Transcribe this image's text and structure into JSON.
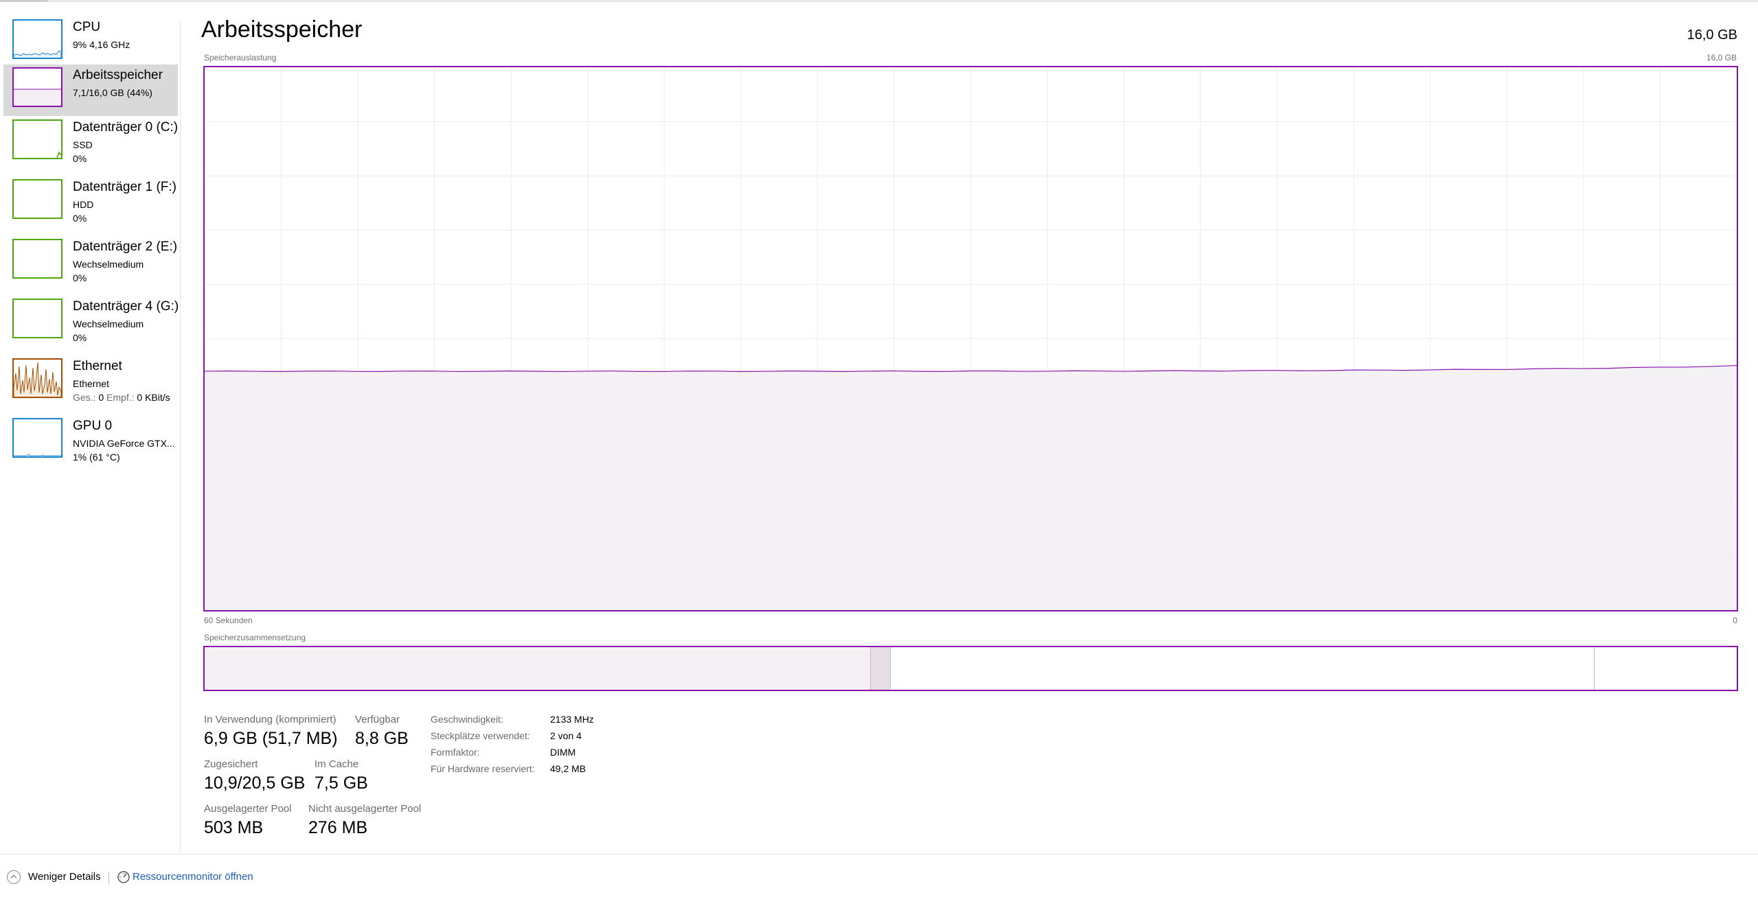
{
  "sidebar": {
    "items": [
      {
        "title": "CPU",
        "line1": "9%  4,16 GHz",
        "line2": "",
        "color": "#1b86d1",
        "selected": false
      },
      {
        "title": "Arbeitsspeicher",
        "line1": "7,1/16,0 GB (44%)",
        "line2": "",
        "color": "#8b12ae",
        "selected": true
      },
      {
        "title": "Datenträger 0 (C:)",
        "line1": "SSD",
        "line2": "0%",
        "color": "#4da60c",
        "selected": false
      },
      {
        "title": "Datenträger 1 (F:)",
        "line1": "HDD",
        "line2": "0%",
        "color": "#4da60c",
        "selected": false
      },
      {
        "title": "Datenträger 2 (E:)",
        "line1": "Wechselmedium",
        "line2": "0%",
        "color": "#4da60c",
        "selected": false
      },
      {
        "title": "Datenträger 4 (G:)",
        "line1": "Wechselmedium",
        "line2": "0%",
        "color": "#4da60c",
        "selected": false
      },
      {
        "title": "Ethernet",
        "line1": "Ethernet",
        "line2_label_send": "Ges.:",
        "line2_value_send": "0",
        "line2_label_recv": "Empf.:",
        "line2_value_recv": "0 KBit/s",
        "color": "#a74f01",
        "selected": false
      },
      {
        "title": "GPU 0",
        "line1": "NVIDIA GeForce GTX...",
        "line2": "1%  (61 °C)",
        "color": "#1b86d1",
        "selected": false
      }
    ]
  },
  "main": {
    "title": "Arbeitsspeicher",
    "total": "16,0 GB",
    "usage_label": "Speicherauslastung",
    "usage_max": "16,0 GB",
    "time_label": "60 Sekunden",
    "time_end": "0",
    "composition_label": "Speicherzusammensetzung"
  },
  "usage_graph": {
    "max_gb": 16.0,
    "used_fraction_start": 0.44,
    "used_fraction_end": 0.45,
    "line_color": "#8b12ae",
    "fill_color": "#f3f0f4"
  },
  "composition": {
    "in_use_fraction": 0.433,
    "modified_fraction": 0.013,
    "standby_fraction": 0.466,
    "free_fraction": 0.088
  },
  "stats": {
    "in_use_label": "In Verwendung (komprimiert)",
    "in_use_value": "6,9 GB (51,7 MB)",
    "available_label": "Verfügbar",
    "available_value": "8,8 GB",
    "committed_label": "Zugesichert",
    "committed_value": "10,9/20,5 GB",
    "cached_label": "Im Cache",
    "cached_value": "7,5 GB",
    "paged_label": "Ausgelagerter Pool",
    "paged_value": "503 MB",
    "nonpaged_label": "Nicht ausgelagerter Pool",
    "nonpaged_value": "276 MB"
  },
  "props": [
    {
      "key": "Geschwindigkeit:",
      "value": "2133 MHz"
    },
    {
      "key": "Steckplätze verwendet:",
      "value": "2 von 4"
    },
    {
      "key": "Formfaktor:",
      "value": "DIMM"
    },
    {
      "key": "Für Hardware reserviert:",
      "value": "49,2 MB"
    }
  ],
  "footer": {
    "less_details": "Weniger Details",
    "resource_monitor": "Ressourcenmonitor öffnen"
  }
}
